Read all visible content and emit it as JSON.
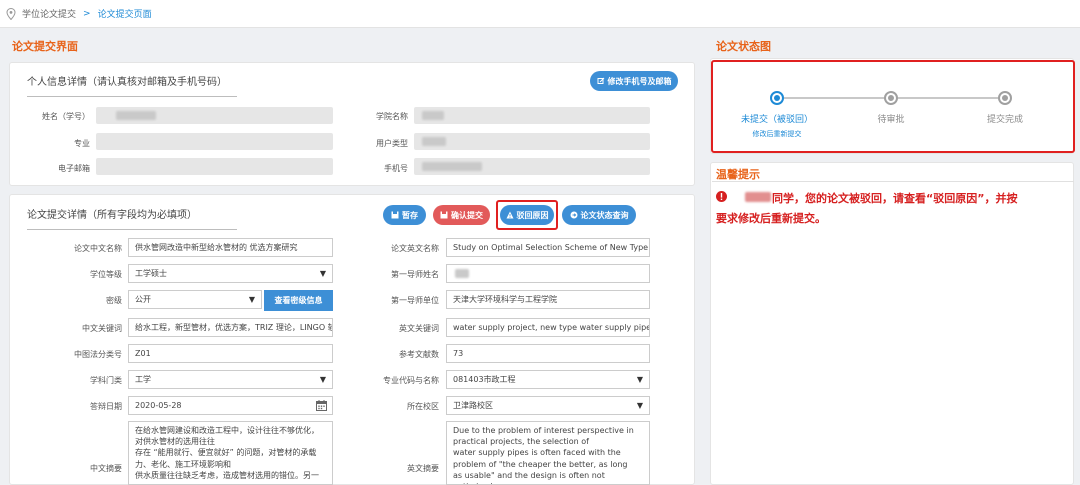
{
  "breadcrumb": {
    "item1": "学位论文提交",
    "separator": ">",
    "item2": "论文提交页面",
    "icon": "location-pin-icon"
  },
  "left": {
    "section_title": "论文提交界面",
    "personal": {
      "title": "个人信息详情（请认真核对邮箱及手机号码）",
      "edit_button": "修改手机号及邮箱",
      "labels": {
        "name": "姓名（学号）",
        "school": "学院名称",
        "major": "专业",
        "user_type": "用户类型",
        "email": "电子邮箱",
        "phone": "手机号"
      }
    },
    "thesis": {
      "title": "论文提交详情（所有字段均为必填项）",
      "buttons": {
        "save": "暂存",
        "confirm": "确认提交",
        "reject_reason": "驳回原因",
        "status_query": "论文状态查询"
      },
      "fields": {
        "title_cn": {
          "label": "论文中文名称",
          "value": "供水管网改造中新型给水管材的 优选方案研究"
        },
        "title_en": {
          "label": "论文英文名称",
          "value": "Study on Optimal Selection Scheme of New Type W"
        },
        "degree_level": {
          "label": "学位等级",
          "value": "工学硕士"
        },
        "advisor_name": {
          "label": "第一导师姓名",
          "value": ""
        },
        "secret_level": {
          "label": "密级",
          "value": "公开",
          "button": "查看密级信息"
        },
        "advisor_unit": {
          "label": "第一导师单位",
          "value": "天津大学环境科学与工程学院"
        },
        "keywords_cn": {
          "label": "中文关键词",
          "value": "给水工程，新型管材，优选方案，TRIZ 理论，LINGO 软"
        },
        "keywords_en": {
          "label": "英文关键词",
          "value": "water supply project, new type water supply pipe, op"
        },
        "clc_number": {
          "label": "中图法分类号",
          "value": "Z01"
        },
        "references": {
          "label": "参考文献数",
          "value": "73"
        },
        "discipline": {
          "label": "学科门类",
          "value": "工学"
        },
        "major_code": {
          "label": "专业代码与名称",
          "value": "081403市政工程"
        },
        "defense_date": {
          "label": "答辩日期",
          "value": "2020-05-28"
        },
        "campus": {
          "label": "所在校区",
          "value": "卫津路校区"
        },
        "abstract_cn": {
          "label": "中文摘要",
          "lines": [
            "在给水管网建设和改造工程中，设计往往不够优化，",
            "对供水管材的选用往往",
            "存在 “能用就行、便宜就好” 的问题，对管材的承载",
            "力、老化、施工环境影响和",
            "供水质量往往缺乏考虑，造成管材选用的错位。另一"
          ]
        },
        "abstract_en": {
          "label": "英文摘要",
          "lines": [
            "Due to the problem of interest perspective in",
            "practical projects, the selection of",
            "water supply pipes is often faced with the",
            "problem of \"the cheaper the better, as long",
            "as usable\" and the design is often not optimized."
          ]
        }
      }
    }
  },
  "right": {
    "status_title": "论文状态图",
    "steps": [
      {
        "label": "未提交（被驳回）",
        "sub": "修改后重新提交",
        "active": true
      },
      {
        "label": "待审批",
        "sub": "",
        "active": false
      },
      {
        "label": "提交完成",
        "sub": "",
        "active": false
      }
    ],
    "tip_title": "温馨提示",
    "tip_icon": "exclamation-circle-icon",
    "tip_text_line1": "同学，您的论文被驳回，请查看“驳回原因”，并按",
    "tip_text_line2": "要求修改后重新提交。"
  },
  "colors": {
    "accent_orange": "#e8631a",
    "primary_blue": "#3d8fd6",
    "danger_red": "#e25a5a",
    "highlight_red": "#e02020"
  }
}
